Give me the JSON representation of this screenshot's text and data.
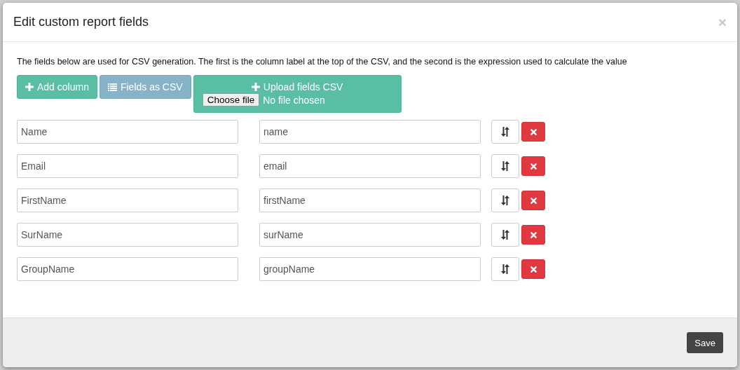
{
  "modal": {
    "title": "Edit custom report fields",
    "close": "×"
  },
  "description": "The fields below are used for CSV generation. The first is the column label at the top of the CSV, and the second is the expression used to calculate the value",
  "toolbar": {
    "add_column": "Add column",
    "fields_as_csv": "Fields as CSV",
    "upload": {
      "label": "Upload fields CSV",
      "choose_file": "Choose file",
      "file_status": "No file chosen"
    }
  },
  "rows": [
    {
      "label": "Name",
      "expression": "name"
    },
    {
      "label": "Email",
      "expression": "email"
    },
    {
      "label": "FirstName",
      "expression": "firstName"
    },
    {
      "label": "SurName",
      "expression": "surName"
    },
    {
      "label": "GroupName",
      "expression": "groupName"
    }
  ],
  "footer": {
    "save": "Save"
  }
}
